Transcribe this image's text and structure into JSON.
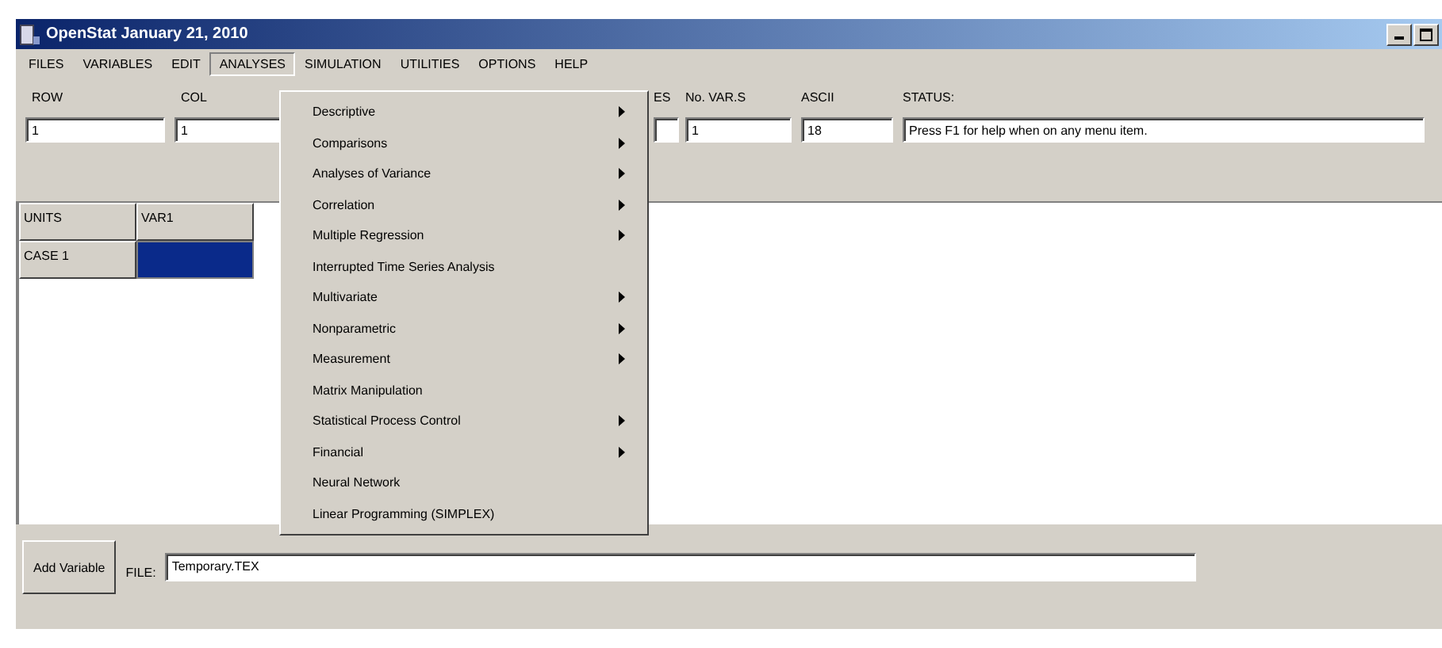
{
  "window": {
    "title": "OpenStat January 21, 2010"
  },
  "menu_bar": [
    {
      "label": "FILES",
      "selected": false
    },
    {
      "label": "VARIABLES",
      "selected": false
    },
    {
      "label": "EDIT",
      "selected": false
    },
    {
      "label": "ANALYSES",
      "selected": true
    },
    {
      "label": "SIMULATION",
      "selected": false
    },
    {
      "label": "UTILITIES",
      "selected": false
    },
    {
      "label": "OPTIONS",
      "selected": false
    },
    {
      "label": "HELP",
      "selected": false
    }
  ],
  "fields": [
    {
      "label": "ROW",
      "value": "1"
    },
    {
      "label": "COL",
      "value": "1"
    },
    {
      "label": "ES"
    },
    {
      "label": "No. VAR.S",
      "value": "1"
    },
    {
      "label": "ASCII",
      "value": "18"
    },
    {
      "label": "STATUS:",
      "value": "Press F1 for help when on any menu item."
    }
  ],
  "grid": {
    "columns": [
      "UNITS",
      "VAR1"
    ],
    "rows": [
      {
        "label": "CASE 1",
        "cells": [
          {
            "selected": true
          }
        ]
      }
    ]
  },
  "analyses_menu": [
    {
      "label": "Descriptive",
      "submenu": true
    },
    {
      "label": "Comparisons",
      "submenu": true
    },
    {
      "label": "Analyses of Variance",
      "submenu": true
    },
    {
      "label": "Correlation",
      "submenu": true
    },
    {
      "label": "Multiple Regression",
      "submenu": true
    },
    {
      "label": "Interrupted Time Series Analysis",
      "submenu": false
    },
    {
      "label": "Multivariate",
      "submenu": true
    },
    {
      "label": "Nonparametric",
      "submenu": true
    },
    {
      "label": "Measurement",
      "submenu": true
    },
    {
      "label": "Matrix Manipulation",
      "submenu": false
    },
    {
      "label": "Statistical Process Control",
      "submenu": true
    },
    {
      "label": "Financial",
      "submenu": true
    },
    {
      "label": "Neural Network",
      "submenu": false
    },
    {
      "label": "Linear Programming (SIMPLEX)",
      "submenu": false
    }
  ],
  "bottom_bar": {
    "button": "Add Variable",
    "file_label": "FILE:",
    "file_value": "Temporary.TEX"
  }
}
